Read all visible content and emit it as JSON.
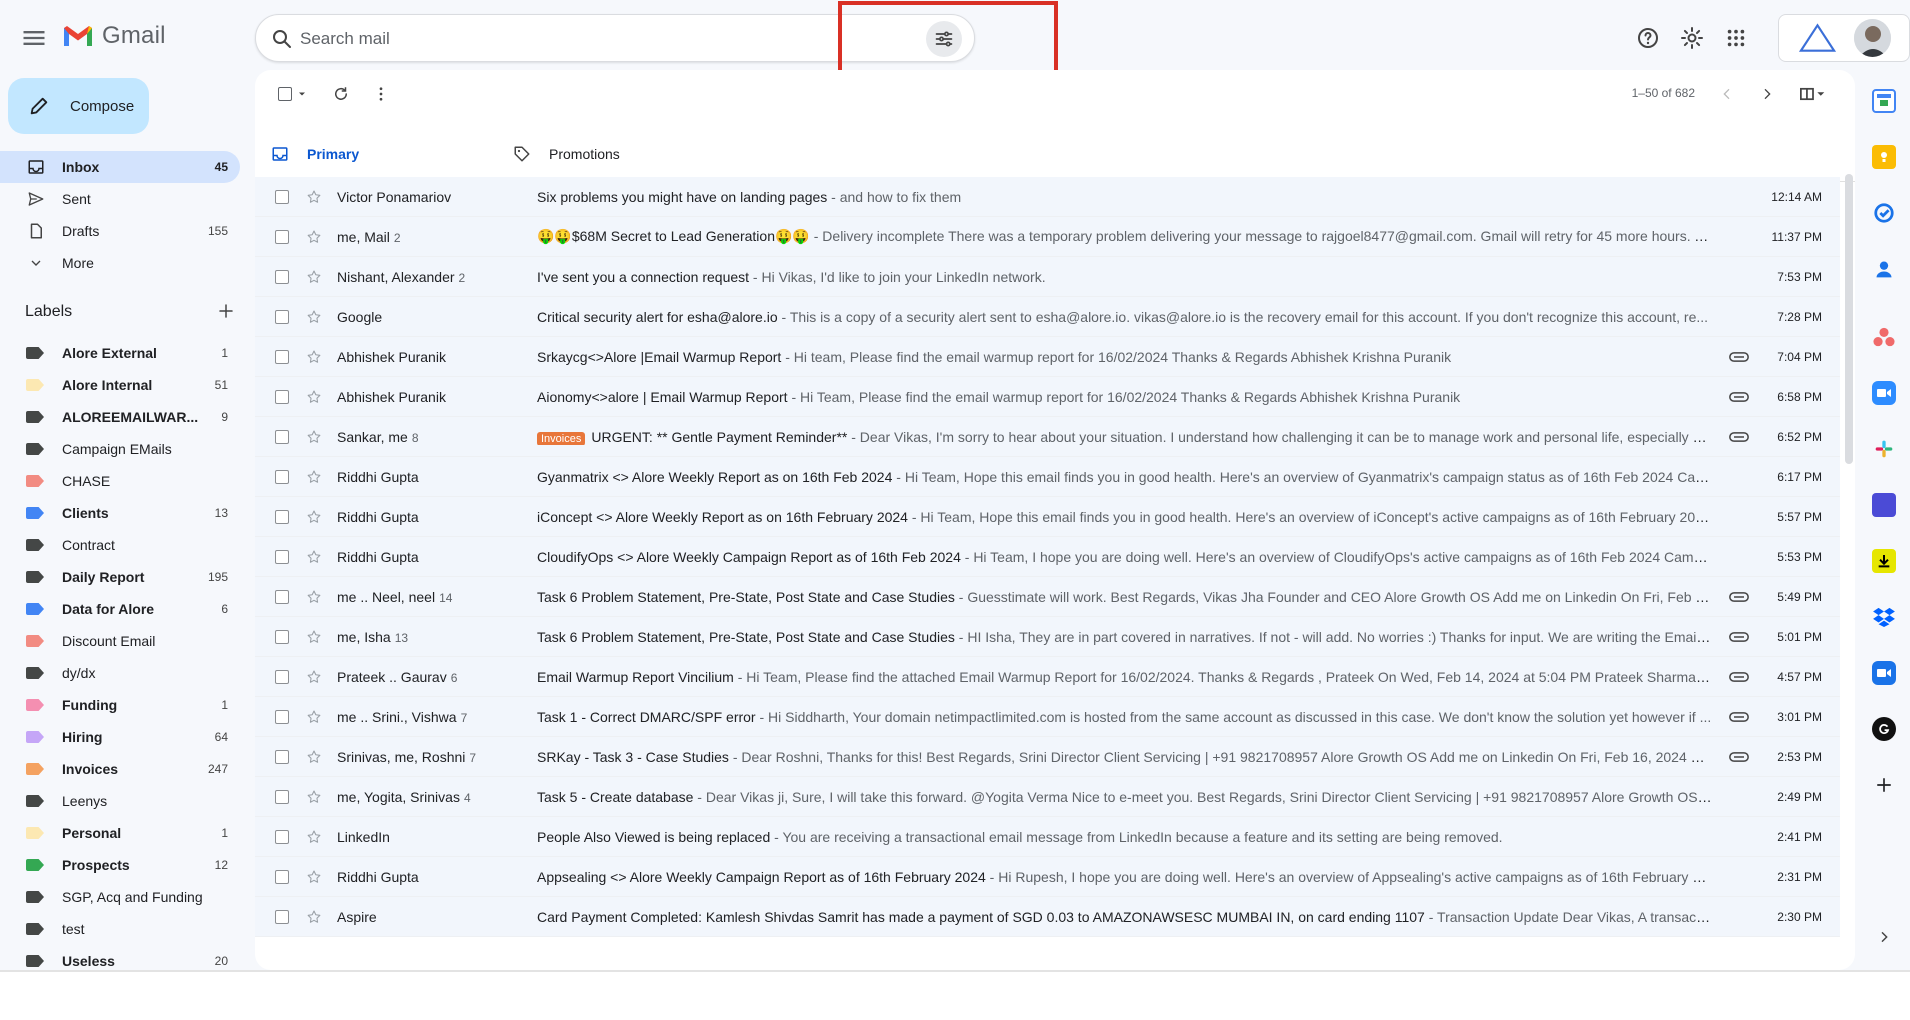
{
  "app": {
    "name": "Gmail"
  },
  "search": {
    "placeholder": "Search mail"
  },
  "compose": {
    "label": "Compose"
  },
  "nav": [
    {
      "label": "Inbox",
      "count": "45",
      "icon": "inbox-icon",
      "active": true
    },
    {
      "label": "Sent",
      "count": "",
      "icon": "send-icon",
      "active": false
    },
    {
      "label": "Drafts",
      "count": "155",
      "icon": "draft-icon",
      "active": false
    },
    {
      "label": "More",
      "count": "",
      "icon": "chevron-down-icon",
      "active": false
    }
  ],
  "labels_title": "Labels",
  "labels": [
    {
      "label": "Alore External",
      "count": "1",
      "color": "#444746",
      "bold": true
    },
    {
      "label": "Alore Internal",
      "count": "51",
      "color": "#fce8b2",
      "bold": true
    },
    {
      "label": "ALOREEMAILWAR...",
      "count": "9",
      "color": "#444746",
      "bold": true
    },
    {
      "label": "Campaign EMails",
      "count": "",
      "color": "#444746",
      "bold": false
    },
    {
      "label": "CHASE",
      "count": "",
      "color": "#f28b82",
      "bold": false
    },
    {
      "label": "Clients",
      "count": "13",
      "color": "#4285f4",
      "bold": true
    },
    {
      "label": "Contract",
      "count": "",
      "color": "#444746",
      "bold": false
    },
    {
      "label": "Daily Report",
      "count": "195",
      "color": "#444746",
      "bold": true
    },
    {
      "label": "Data for Alore",
      "count": "6",
      "color": "#4285f4",
      "bold": true
    },
    {
      "label": "Discount Email",
      "count": "",
      "color": "#f28b82",
      "bold": false
    },
    {
      "label": "dy/dx",
      "count": "",
      "color": "#444746",
      "bold": false
    },
    {
      "label": "Funding",
      "count": "1",
      "color": "#f48fb1",
      "bold": true
    },
    {
      "label": "Hiring",
      "count": "64",
      "color": "#c5a6f7",
      "bold": true
    },
    {
      "label": "Invoices",
      "count": "247",
      "color": "#f4a261",
      "bold": true
    },
    {
      "label": "Leenys",
      "count": "",
      "color": "#444746",
      "bold": false
    },
    {
      "label": "Personal",
      "count": "1",
      "color": "#fce8b2",
      "bold": true
    },
    {
      "label": "Prospects",
      "count": "12",
      "color": "#34a853",
      "bold": true
    },
    {
      "label": "SGP, Acq and Funding",
      "count": "",
      "color": "#444746",
      "bold": false
    },
    {
      "label": "test",
      "count": "",
      "color": "#444746",
      "bold": false
    },
    {
      "label": "Useless",
      "count": "20",
      "color": "#444746",
      "bold": true
    }
  ],
  "pager": {
    "text": "1–50 of 682"
  },
  "tabs": [
    {
      "label": "Primary",
      "icon": "inbox-icon",
      "active": true
    },
    {
      "label": "Promotions",
      "icon": "tag-icon",
      "active": false
    }
  ],
  "emails": [
    {
      "sender": "Victor Ponamariov",
      "count": "",
      "badge": "",
      "subject": "Six problems you might have on landing pages",
      "snippet": " - and how to fix them",
      "attachment": false,
      "time": "12:14 AM"
    },
    {
      "sender": "me, Mail",
      "count": "2",
      "badge": "",
      "subject": "🤑🤑$68M Secret to Lead Generation🤑🤑",
      "snippet": " - Delivery incomplete There was a temporary problem delivering your message to rajgoel8477@gmail.com. Gmail will retry for 45 more hours. Yo...",
      "attachment": false,
      "time": "11:37 PM"
    },
    {
      "sender": "Nishant, Alexander",
      "count": "2",
      "badge": "",
      "subject": "I've sent you a connection request",
      "snippet": " - Hi Vikas, I'd like to join your LinkedIn network.",
      "attachment": false,
      "time": "7:53 PM"
    },
    {
      "sender": "Google",
      "count": "",
      "badge": "",
      "subject": "Critical security alert for esha@alore.io",
      "snippet": " - This is a copy of a security alert sent to esha@alore.io. vikas@alore.io is the recovery email for this account. If you don't recognize this account, re...",
      "attachment": false,
      "time": "7:28 PM"
    },
    {
      "sender": "Abhishek Puranik",
      "count": "",
      "badge": "",
      "subject": "Srkaycg<>Alore |Email Warmup Report",
      "snippet": " - Hi team, Please find the email warmup report for 16/02/2024 Thanks & Regards Abhishek Krishna Puranik",
      "attachment": true,
      "time": "7:04 PM"
    },
    {
      "sender": "Abhishek Puranik",
      "count": "",
      "badge": "",
      "subject": "Aionomy<>alore | Email Warmup Report",
      "snippet": " - Hi Team, Please find the email warmup report for 16/02/2024 Thanks & Regards Abhishek Krishna Puranik",
      "attachment": true,
      "time": "6:58 PM"
    },
    {
      "sender": "Sankar, me",
      "count": "8",
      "badge": "Invoices",
      "subject": "URGENT: ** Gentle Payment Reminder**",
      "snippet": " - Dear Vikas, I'm sorry to hear about your situation. I understand how challenging it can be to manage work and personal life, especially d...",
      "attachment": true,
      "time": "6:52 PM"
    },
    {
      "sender": "Riddhi Gupta",
      "count": "",
      "badge": "",
      "subject": "Gyanmatrix <> Alore Weekly Report as on 16th Feb 2024",
      "snippet": " - Hi Team, Hope this email finds you in good health. Here's an overview of Gyanmatrix's campaign status as of 16th Feb 2024 Camp...",
      "attachment": false,
      "time": "6:17 PM"
    },
    {
      "sender": "Riddhi Gupta",
      "count": "",
      "badge": "",
      "subject": "iConcept <> Alore Weekly Report as on 16th February 2024",
      "snippet": " - Hi Team, Hope this email finds you in good health. Here's an overview of iConcept's active campaigns as of 16th February 2024...",
      "attachment": false,
      "time": "5:57 PM"
    },
    {
      "sender": "Riddhi Gupta",
      "count": "",
      "badge": "",
      "subject": "CloudifyOps <> Alore Weekly Campaign Report as of 16th Feb 2024",
      "snippet": " - Hi Team, I hope you are doing well. Here's an overview of CloudifyOps's active campaigns as of 16th Feb 2024 Campai...",
      "attachment": false,
      "time": "5:53 PM"
    },
    {
      "sender": "me .. Neel, neel",
      "count": "14",
      "badge": "",
      "subject": "Task 6 Problem Statement, Pre-State, Post State and Case Studies",
      "snippet": " - Guesstimate will work. Best Regards, Vikas Jha Founder and CEO Alore Growth OS Add me on Linkedin On Fri, Feb 16, 2...",
      "attachment": true,
      "time": "5:49 PM"
    },
    {
      "sender": "me, Isha",
      "count": "13",
      "badge": "",
      "subject": "Task 6 Problem Statement, Pre-State, Post State and Case Studies",
      "snippet": " - HI Isha, They are in part covered in narratives. If not - will add. No worries :) Thanks for input. We are writing the Email C...",
      "attachment": true,
      "time": "5:01 PM"
    },
    {
      "sender": "Prateek .. Gaurav",
      "count": "6",
      "badge": "",
      "subject": "Email Warmup Report Vincilium",
      "snippet": " - Hi Team, Please find the attached Email Warmup Report for 16/02/2024. Thanks & Regards , Prateek On Wed, Feb 14, 2024 at 5:04 PM Prateek Sharma <pr...",
      "attachment": true,
      "time": "4:57 PM"
    },
    {
      "sender": "me .. Srini., Vishwa",
      "count": "7",
      "badge": "",
      "subject": "Task 1 - Correct DMARC/SPF error",
      "snippet": " - Hi Siddharth, Your domain netimpactlimited.com is hosted from the same account as discussed in this case. We don't know the solution yet however if ...",
      "attachment": true,
      "time": "3:01 PM"
    },
    {
      "sender": "Srinivas, me, Roshni",
      "count": "7",
      "badge": "",
      "subject": "SRKay - Task 3 - Case Studies",
      "snippet": " - Dear Roshni, Thanks for this! Best Regards, Srini Director Client Servicing | +91 9821708957 Alore Growth OS Add me on Linkedin On Fri, Feb 16, 2024 at 2:43...",
      "attachment": true,
      "time": "2:53 PM"
    },
    {
      "sender": "me, Yogita, Srinivas",
      "count": "4",
      "badge": "",
      "subject": "Task 5 - Create database",
      "snippet": " - Dear Vikas ji, Sure, I will take this forward. @Yogita Verma Nice to e-meet you. Best Regards, Srini Director Client Servicing | +91 9821708957 Alore Growth OS Ad...",
      "attachment": false,
      "time": "2:49 PM"
    },
    {
      "sender": "LinkedIn",
      "count": "",
      "badge": "",
      "subject": "People Also Viewed is being replaced",
      "snippet": " - You are receiving a transactional email message from LinkedIn because a feature and its setting are being removed.",
      "attachment": false,
      "time": "2:41 PM"
    },
    {
      "sender": "Riddhi Gupta",
      "count": "",
      "badge": "",
      "subject": "Appsealing <> Alore Weekly Campaign Report as of 16th February 2024",
      "snippet": " - Hi Rupesh, I hope you are doing well. Here's an overview of Appsealing's active campaigns as of 16th February 202...",
      "attachment": false,
      "time": "2:31 PM"
    },
    {
      "sender": "Aspire",
      "count": "",
      "badge": "",
      "subject": "Card Payment Completed: Kamlesh Shivdas Samrit has made a payment of SGD 0.03 to AMAZONAWSESC MUMBAI IN, on card ending 1107",
      "snippet": " - Transaction Update Dear Vikas, A transaction ...",
      "attachment": false,
      "time": "2:30 PM"
    }
  ],
  "colors": {
    "accent": "#0b57d0",
    "compose_bg": "#c2e7ff",
    "active_nav": "#d3e3fd",
    "highlight": "#d93025",
    "badge": "#e8763a"
  }
}
